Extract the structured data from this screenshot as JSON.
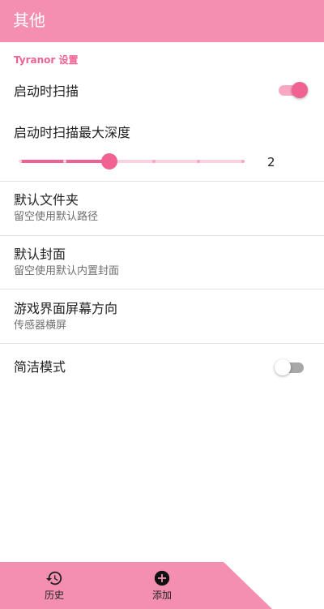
{
  "app_bar": {
    "title": "其他"
  },
  "section": {
    "title": "Tyranor 设置"
  },
  "prefs": {
    "scan_on_start": {
      "title": "启动时扫描",
      "checked": true
    },
    "scan_depth": {
      "title": "启动时扫描最大深度",
      "value": 2,
      "min": 0,
      "max": 5,
      "display": "2"
    },
    "default_folder": {
      "title": "默认文件夹",
      "summary": "留空使用默认路径"
    },
    "default_cover": {
      "title": "默认封面",
      "summary": "留空使用默认内置封面"
    },
    "orientation": {
      "title": "游戏界面屏幕方向",
      "summary": "传感器横屏"
    },
    "simple_mode": {
      "title": "简洁模式",
      "checked": false
    }
  },
  "bottom_nav": {
    "items": [
      {
        "label": "历史",
        "icon": "history-icon"
      },
      {
        "label": "添加",
        "icon": "add-circle-icon"
      }
    ]
  },
  "colors": {
    "primary": "#f48fb1",
    "accent": "#f06292",
    "accent_light": "#f8a8c4",
    "switch_off_track": "#a8a8a8"
  }
}
